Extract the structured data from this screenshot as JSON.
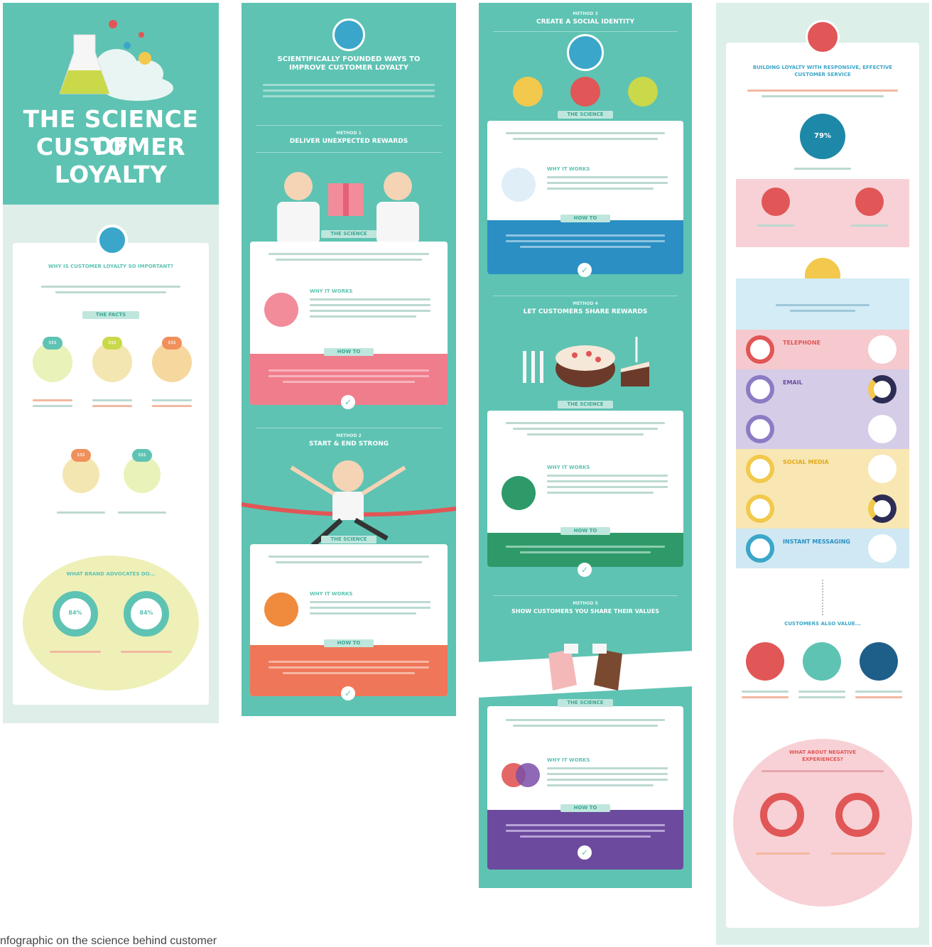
{
  "panel1": {
    "title_line1": "THE SCIENCE OF",
    "title_line2": "CUSTOMER",
    "title_line3": "LOYALTY",
    "why_heading": "Why is Customer Loyalty so Important?",
    "facts_label": "The Facts",
    "advocates_heading": "What brand advocates do...",
    "stat_a": "84%",
    "stat_b": "84%",
    "badge_a": "$$$",
    "badge_b": "$$$",
    "badge_c": "$$$",
    "badge_d": "$$$",
    "badge_e": "$$$"
  },
  "panel2": {
    "header": "Scientifically Founded Ways to Improve Customer Loyalty",
    "method1_label": "Method 1",
    "method1_title": "Deliver Unexpected Rewards",
    "method2_label": "Method 2",
    "method2_title": "Start & End Strong",
    "science_label": "The Science",
    "why_label": "Why it Works",
    "howto_label": "How To"
  },
  "panel3": {
    "method3_label": "Method 3",
    "method3_title": "Create a Social Identity",
    "method4_label": "Method 4",
    "method4_title": "Let Customers Share Rewards",
    "method5_label": "Method 5",
    "method5_title": "Show Customers You Share Their Values",
    "science_label": "The Science",
    "why_label": "Why it Works",
    "howto_label": "How To"
  },
  "panel4": {
    "heading": "Building Loyalty with Responsive, Effective Customer Service",
    "stat": "79%",
    "channels": [
      {
        "label": "Telephone",
        "color": "#e15656"
      },
      {
        "label": "Email",
        "color": "#8c7bc4"
      },
      {
        "label": "",
        "color": "#8c7bc4"
      },
      {
        "label": "Social Media",
        "color": "#f2c94c"
      },
      {
        "label": "",
        "color": "#f2c94c"
      },
      {
        "label": "Instant Messaging",
        "color": "#3aa6c9"
      }
    ],
    "also_value": "Customers Also Value...",
    "negative_heading": "What about Negative Experiences?"
  },
  "caption": "nfographic on the science behind customer"
}
